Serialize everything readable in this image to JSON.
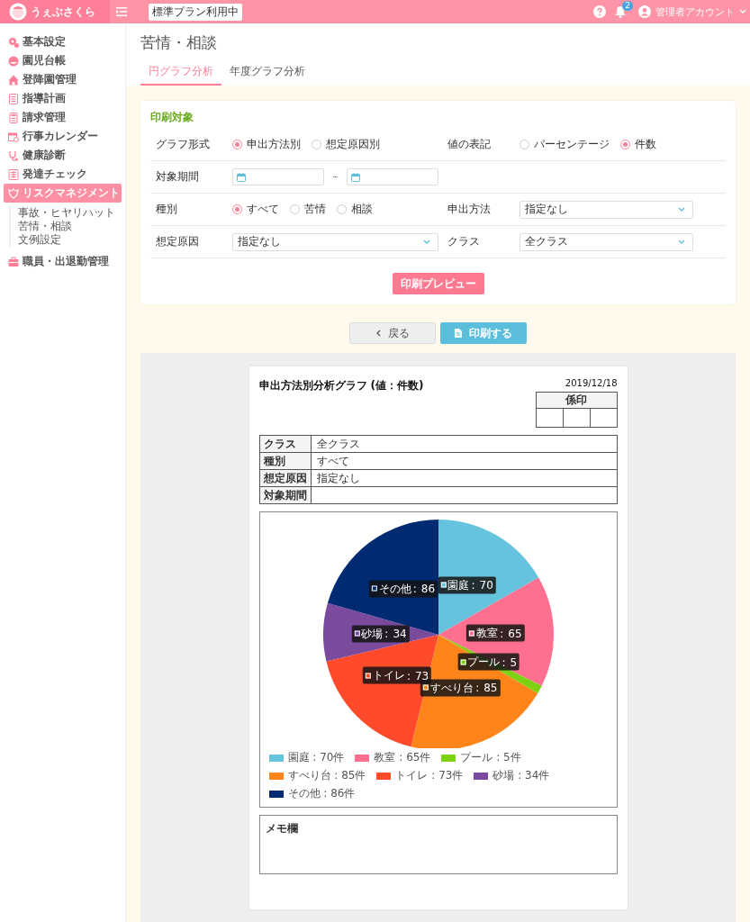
{
  "header": {
    "logo_text": "うぇぶさくら",
    "plan_badge": "標準プラン利用中",
    "notification_count": "2",
    "account": "管理者アカウント"
  },
  "sidebar": {
    "items": [
      {
        "label": "基本設定",
        "selected": false
      },
      {
        "label": "園児台帳",
        "selected": false
      },
      {
        "label": "登降園管理",
        "selected": false
      },
      {
        "label": "指導計画",
        "selected": false
      },
      {
        "label": "請求管理",
        "selected": false
      },
      {
        "label": "行事カレンダー",
        "selected": false
      },
      {
        "label": "健康診断",
        "selected": false
      },
      {
        "label": "発達チェック",
        "selected": false
      },
      {
        "label": "リスクマネジメント",
        "selected": true,
        "children": [
          {
            "label": "事故・ヒヤリハット"
          },
          {
            "label": "苦情・相談"
          },
          {
            "label": "文例設定"
          }
        ]
      },
      {
        "label": "職員・出退勤管理",
        "selected": false
      }
    ]
  },
  "page": {
    "title": "苦情・相談",
    "tabs": [
      {
        "label": "円グラフ分析",
        "selected": true
      },
      {
        "label": "年度グラフ分析",
        "selected": false
      }
    ]
  },
  "form": {
    "title": "印刷対象",
    "fields": [
      {
        "kind": "radio",
        "label": "グラフ形式",
        "options": [
          {
            "label": "申出方法別",
            "selected": true
          },
          {
            "label": "想定原因別",
            "selected": false
          }
        ]
      },
      {
        "kind": "radio",
        "label": "値の表記",
        "options": [
          {
            "label": "パーセンテージ",
            "selected": false
          },
          {
            "label": "件数",
            "selected": true
          }
        ]
      },
      {
        "kind": "daterange",
        "label": "対象期間",
        "separator": "～"
      },
      {
        "kind": "empty"
      },
      {
        "kind": "radio",
        "label": "種別",
        "options": [
          {
            "label": "すべて",
            "selected": true
          },
          {
            "label": "苦情",
            "selected": false
          },
          {
            "label": "相談",
            "selected": false
          }
        ]
      },
      {
        "kind": "select",
        "label": "申出方法",
        "value": "指定なし"
      },
      {
        "kind": "select",
        "label": "想定原因",
        "value": "指定なし"
      },
      {
        "kind": "select",
        "label": "クラス",
        "value": "全クラス"
      }
    ],
    "preview_button": "印刷プレビュー"
  },
  "actions": {
    "back_button": "戻る",
    "print_button": "印刷する"
  },
  "report": {
    "title": "申出方法別分析グラフ",
    "subtitle": "(値：件数)",
    "date": "2019/12/18",
    "stamp_label": "係印",
    "info_rows": [
      {
        "label": "クラス",
        "value": "全クラス"
      },
      {
        "label": "種別",
        "value": "すべて"
      },
      {
        "label": "想定原因",
        "value": "指定なし"
      },
      {
        "label": "対象期間"
      }
    ],
    "chart": {
      "chart_data": {
        "type": "pie",
        "categories": [
          "園庭",
          "教室",
          "プール",
          "すべり台",
          "トイレ",
          "砂場",
          "その他"
        ],
        "values": [
          70,
          65,
          5,
          85,
          73,
          34,
          86
        ],
        "data_labels": true,
        "legend": "bottom"
      },
      "label_separator": ":",
      "legend": [
        {
          "label": "園庭 : 70件",
          "color": "#66c3de"
        },
        {
          "label": "教室 : 65件",
          "color": "#ff7090"
        },
        {
          "label": "プール : 5件",
          "color": "#7ed112"
        },
        {
          "label": "すべり台 : 85件",
          "color": "#ff851b"
        },
        {
          "label": "トイレ : 73件",
          "color": "#ff4a2c"
        },
        {
          "label": "砂場 : 34件",
          "color": "#7a4a9c"
        },
        {
          "label": "その他 : 86件",
          "color": "#002b73"
        }
      ]
    },
    "memo_label": "メモ欄"
  }
}
